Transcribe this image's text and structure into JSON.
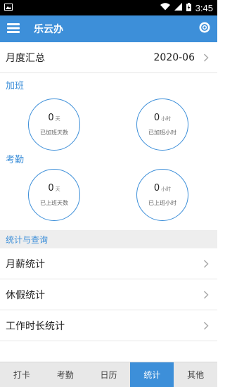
{
  "status_bar": {
    "time": "3:45"
  },
  "app_bar": {
    "title": "乐云办"
  },
  "month": {
    "label": "月度汇总",
    "value": "2020-06"
  },
  "overtime": {
    "section": "加班",
    "days": {
      "value": "0",
      "unit": "天",
      "caption": "已加班天数"
    },
    "hours": {
      "value": "0",
      "unit": "小时",
      "caption": "已加班小时"
    }
  },
  "attendance": {
    "section": "考勤",
    "days": {
      "value": "0",
      "unit": "天",
      "caption": "已上班天数"
    },
    "hours": {
      "value": "0",
      "unit": "小时",
      "caption": "已上班小时"
    }
  },
  "stats": {
    "header": "统计与查询",
    "items": [
      {
        "label": "月薪统计"
      },
      {
        "label": "休假统计"
      },
      {
        "label": "工作时长统计"
      }
    ]
  },
  "tabs": [
    {
      "label": "打卡",
      "active": false
    },
    {
      "label": "考勤",
      "active": false
    },
    {
      "label": "日历",
      "active": false
    },
    {
      "label": "统计",
      "active": true
    },
    {
      "label": "其他",
      "active": false
    }
  ],
  "colors": {
    "accent": "#3d8fd9",
    "tab_bar": "#e8e8e8"
  }
}
